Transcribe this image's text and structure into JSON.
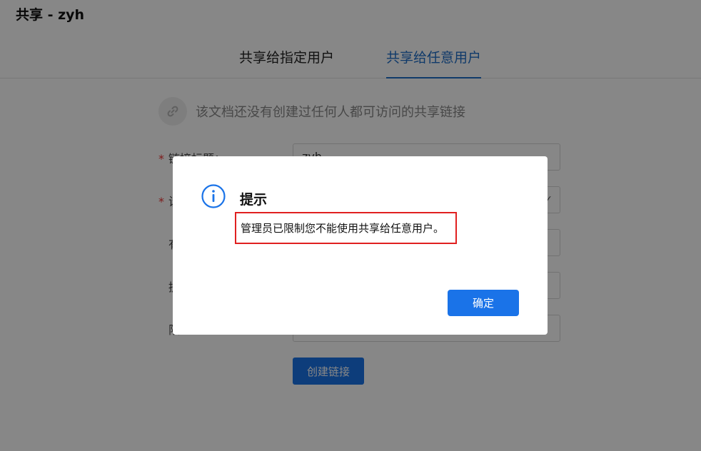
{
  "window": {
    "title": "共享 - zyh"
  },
  "tabs": [
    {
      "label": "共享给指定用户",
      "active": false
    },
    {
      "label": "共享给任意用户",
      "active": true
    }
  ],
  "notice": {
    "icon": "link-icon",
    "text": "该文档还没有创建过任何人都可访问的共享链接"
  },
  "form": {
    "link_title": {
      "label": "链接标题：",
      "value": "zyh",
      "required": true
    },
    "row2": {
      "label": "设",
      "required": true
    },
    "row3": {
      "label": "有"
    },
    "row4": {
      "label": "提"
    },
    "row5": {
      "label": "限"
    },
    "create_button": "创建链接"
  },
  "dialog": {
    "icon": "info-icon",
    "title": "提示",
    "message": "管理员已限制您不能使用共享给任意用户。",
    "ok_button": "确定"
  },
  "colors": {
    "accent": "#1a73e8",
    "highlight_border": "#e02020"
  }
}
